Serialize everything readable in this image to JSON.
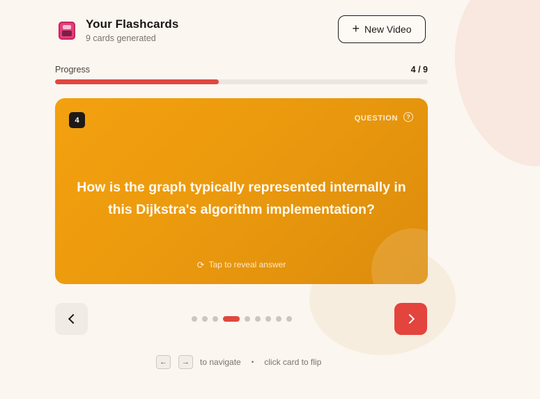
{
  "header": {
    "title": "Your Flashcards",
    "subtitle": "9 cards generated",
    "icon": "video-collection-icon",
    "new_video_label": "New Video"
  },
  "progress": {
    "label": "Progress",
    "count_text": "4 / 9",
    "current": 4,
    "total": 9,
    "fraction": 0.44,
    "accent_color": "#e0473f"
  },
  "card": {
    "number": "4",
    "type_label": "QUESTION",
    "text": "How is the graph typically represented internally in this Dijkstra's algorithm implementation?",
    "hint": "Tap to reveal answer",
    "background_color": "#f0a00f"
  },
  "navigation": {
    "total_dots": 9,
    "active_index": 3,
    "prev_icon": "chevron-left-icon",
    "next_icon": "chevron-right-icon",
    "next_color": "#e3443d"
  },
  "footer": {
    "left_key": "←",
    "right_key": "→",
    "navigate_text": "to navigate",
    "separator": "•",
    "flip_text": "click card to flip"
  }
}
